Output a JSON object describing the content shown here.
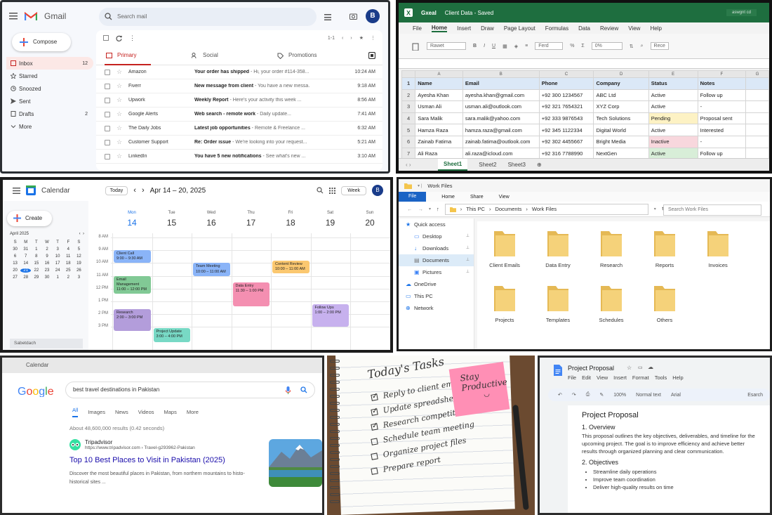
{
  "gmail": {
    "app_name": "Gmail",
    "search_placeholder": "Search mail",
    "avatar": "B",
    "compose": "Compose",
    "nav": [
      {
        "label": "Inbox",
        "count": "12"
      },
      {
        "label": "Starred",
        "count": ""
      },
      {
        "label": "Snoozed",
        "count": ""
      },
      {
        "label": "Sent",
        "count": ""
      },
      {
        "label": "Drafts",
        "count": "2"
      },
      {
        "label": "More",
        "count": ""
      }
    ],
    "pagination": "1-1",
    "tabs": [
      "Primary",
      "Social",
      "Promotions"
    ],
    "emails": [
      {
        "from": "Amazon",
        "subject": "Your order has shipped",
        "snippet": " - Hi, your order #114-358...",
        "time": "10:24 AM"
      },
      {
        "from": "Fiverr",
        "subject": "New message from client",
        "snippet": " - You have a new messa...",
        "time": "9:18 AM"
      },
      {
        "from": "Upwork",
        "subject": "Weekly Report",
        "snippet": " - Here's your activity this week ...",
        "time": "8:56 AM"
      },
      {
        "from": "Google Alerts",
        "subject": "Web search - remote work",
        "snippet": " - Daily update...",
        "time": "7:41 AM"
      },
      {
        "from": "The Daily Jobs",
        "subject": "Latest job opportunities",
        "snippet": " - Remote & Freelance ...",
        "time": "6:32 AM"
      },
      {
        "from": "Customer Support",
        "subject": "Re: Order issue",
        "snippet": " - We're looking into your request...",
        "time": "5:21 AM"
      },
      {
        "from": "LinkedIn",
        "subject": "You have 5 new notifications",
        "snippet": " - See what's new ...",
        "time": "3:10 AM"
      }
    ]
  },
  "excel": {
    "app": "Gxeal",
    "doc_title": "Client Data - Saved",
    "window_label": "aswgnt cd",
    "menus": [
      "File",
      "Home",
      "Insert",
      "Draw",
      "Page Layout",
      "Formulas",
      "Data",
      "Review",
      "View",
      "Help"
    ],
    "ribbon": [
      "Rawet",
      "Ferd",
      "0%",
      "Rece"
    ],
    "columns": [
      "A",
      "B",
      "C",
      "D",
      "E",
      "F",
      "G"
    ],
    "headers": [
      "Name",
      "Email",
      "Phone",
      "Company",
      "Status",
      "Notes"
    ],
    "rows": [
      [
        "Ayesha Khan",
        "ayesha.khan@gmail.com",
        "+92 300 1234567",
        "ABC Ltd",
        "Active",
        "Follow up"
      ],
      [
        "Usman Ali",
        "usman.ali@outlook.com",
        "+92 321 7654321",
        "XYZ Corp",
        "Active",
        "-"
      ],
      [
        "Sara Malik",
        "sara.malik@yahoo.com",
        "+92 333 9876543",
        "Tech Solutions",
        "Pending",
        "Proposal sent"
      ],
      [
        "Hamza Raza",
        "hamza.raza@gmail.com",
        "+92 345 1122334",
        "Digital World",
        "Active",
        "Interested"
      ],
      [
        "Zainab Fatima",
        "zainab.fatima@outlook.com",
        "+92 302 4455667",
        "Bright Media",
        "Inactive",
        "-"
      ],
      [
        "Ali Raza",
        "ali.raza@icloud.com",
        "+92 316 7788990",
        "NextGen",
        "Active",
        "Follow up"
      ]
    ],
    "status_colors": {
      "Active": "#ffffff",
      "Pending": "#fdf2c4",
      "Inactive": "#f8d7dd",
      "ActiveLast": "#d8eed8"
    },
    "sheets": [
      "Sheet1",
      "Sheet2",
      "Sheet3"
    ]
  },
  "calendar": {
    "app": "Calendar",
    "today": "Today",
    "range": "Apr 14 – 20, 2025",
    "view": "Week",
    "avatar": "B",
    "create": "Create",
    "mini_month": "April 2025",
    "mini_days": [
      "S",
      "M",
      "T",
      "W",
      "T",
      "F",
      "S"
    ],
    "mini_dates": [
      "30",
      "31",
      "1",
      "2",
      "3",
      "4",
      "5",
      "6",
      "7",
      "8",
      "9",
      "10",
      "11",
      "12",
      "13",
      "14",
      "15",
      "16",
      "17",
      "18",
      "19",
      "20",
      "21",
      "22",
      "23",
      "24",
      "25",
      "26",
      "27",
      "28",
      "29",
      "30",
      "1",
      "2",
      "3"
    ],
    "selected_date": "21",
    "other_calendars": "Sabetdach",
    "days": [
      {
        "name": "Mon",
        "date": "14"
      },
      {
        "name": "Tue",
        "date": "15"
      },
      {
        "name": "Wed",
        "date": "16"
      },
      {
        "name": "Thu",
        "date": "17"
      },
      {
        "name": "Fri",
        "date": "18"
      },
      {
        "name": "Sat",
        "date": "19"
      },
      {
        "name": "Sun",
        "date": "20"
      }
    ],
    "hours": [
      "8 AM",
      "9 AM",
      "10 AM",
      "11 AM",
      "12 PM",
      "1 PM",
      "2 PM",
      "3 PM"
    ],
    "events": [
      {
        "title": "Client Call",
        "time": "9:00 – 9:30 AM",
        "day": 0,
        "start": 9,
        "end": 10,
        "color": "#8ab4f8"
      },
      {
        "title": "Email Management",
        "time": "11:00 – 12:00 PM",
        "day": 0,
        "start": 11,
        "end": 12.4,
        "color": "#81c995"
      },
      {
        "title": "Research",
        "time": "2:00 – 3:00 PM",
        "day": 0,
        "start": 13.6,
        "end": 15.3,
        "color": "#b39ddb"
      },
      {
        "title": "Project Update",
        "time": "3:00 – 4:00 PM",
        "day": 1,
        "start": 15.1,
        "end": 16.2,
        "color": "#78d9c5"
      },
      {
        "title": "Team Meeting",
        "time": "10:00 – 11:00 AM",
        "day": 2,
        "start": 10,
        "end": 11,
        "color": "#8ab4f8"
      },
      {
        "title": "Data Entry",
        "time": "11:30 – 1:00 PM",
        "day": 3,
        "start": 11.5,
        "end": 13.4,
        "color": "#f48fb1"
      },
      {
        "title": "Content Review",
        "time": "10:00 – 11:00 AM",
        "day": 4,
        "start": 9.8,
        "end": 10.8,
        "color": "#fbc870"
      },
      {
        "title": "Follow Ups",
        "time": "1:00 – 2:00 PM",
        "day": 5,
        "start": 13.2,
        "end": 15.0,
        "color": "#c7b1ee"
      }
    ]
  },
  "explorer": {
    "title": "Work Files",
    "menus": [
      "File",
      "Home",
      "Share",
      "View"
    ],
    "path": [
      "This PC",
      "Documents",
      "Work Files"
    ],
    "search_placeholder": "Search Work Files",
    "tree": [
      {
        "label": "Quick access",
        "sub": false
      },
      {
        "label": "Desktop",
        "sub": true
      },
      {
        "label": "Downloads",
        "sub": true
      },
      {
        "label": "Documents",
        "sub": true
      },
      {
        "label": "Pictures",
        "sub": true
      },
      {
        "label": "OneDrive",
        "sub": false
      },
      {
        "label": "This PC",
        "sub": false
      },
      {
        "label": "Network",
        "sub": false
      }
    ],
    "folders": [
      "Client Emails",
      "Data Entry",
      "Research",
      "Reports",
      "Invoices",
      "Projects",
      "Templates",
      "Schedules",
      "Others"
    ]
  },
  "google": {
    "tab_title": "Calendar",
    "query": "best travel destinations in Pakistan",
    "tabs": [
      "All",
      "Images",
      "News",
      "Videos",
      "Maps",
      "More"
    ],
    "count": "About 48,600,000 results (0.42 seconds)",
    "result": {
      "site": "Tripadvisor",
      "url": "https://www.tripadvisor.com › Travel-g293962-Pakistan",
      "title": "Top 10 Best Places to Visit in Pakistan (2025)",
      "snippet_1": "Discover the most beautiful places in Pakistan, from northern mountains to histo-",
      "snippet_2": "historical sites ..."
    }
  },
  "notebook": {
    "title": "Today's Tasks",
    "tasks": [
      {
        "text": "Reply to client emails",
        "done": true
      },
      {
        "text": "Update spreadsheet",
        "done": true
      },
      {
        "text": "Research competitors",
        "done": true
      },
      {
        "text": "Schedule team meeting",
        "done": false
      },
      {
        "text": "Organize project files",
        "done": false
      },
      {
        "text": "Prepare report",
        "done": false
      }
    ],
    "sticky_1": "Stay",
    "sticky_2": "Productive"
  },
  "docs": {
    "title": "Project Proposal",
    "menus": [
      "File",
      "Edit",
      "View",
      "Insert",
      "Format",
      "Tools",
      "Help"
    ],
    "zoom": "100%",
    "style": "Normal text",
    "font": "Arial",
    "search": "Esarch",
    "heading": "Project Proposal",
    "section1": "1. Overview",
    "overview": "This proposal outlines the key objectives, deliverables, and timeline for the upcoming project. The goal is to improve efficiency and achieve better results through organized planning and clear communication.",
    "section2": "2. Objectives",
    "objectives": [
      "Streamline daily operations",
      "Improve team coordination",
      "Deliver high-quality results on time"
    ]
  }
}
